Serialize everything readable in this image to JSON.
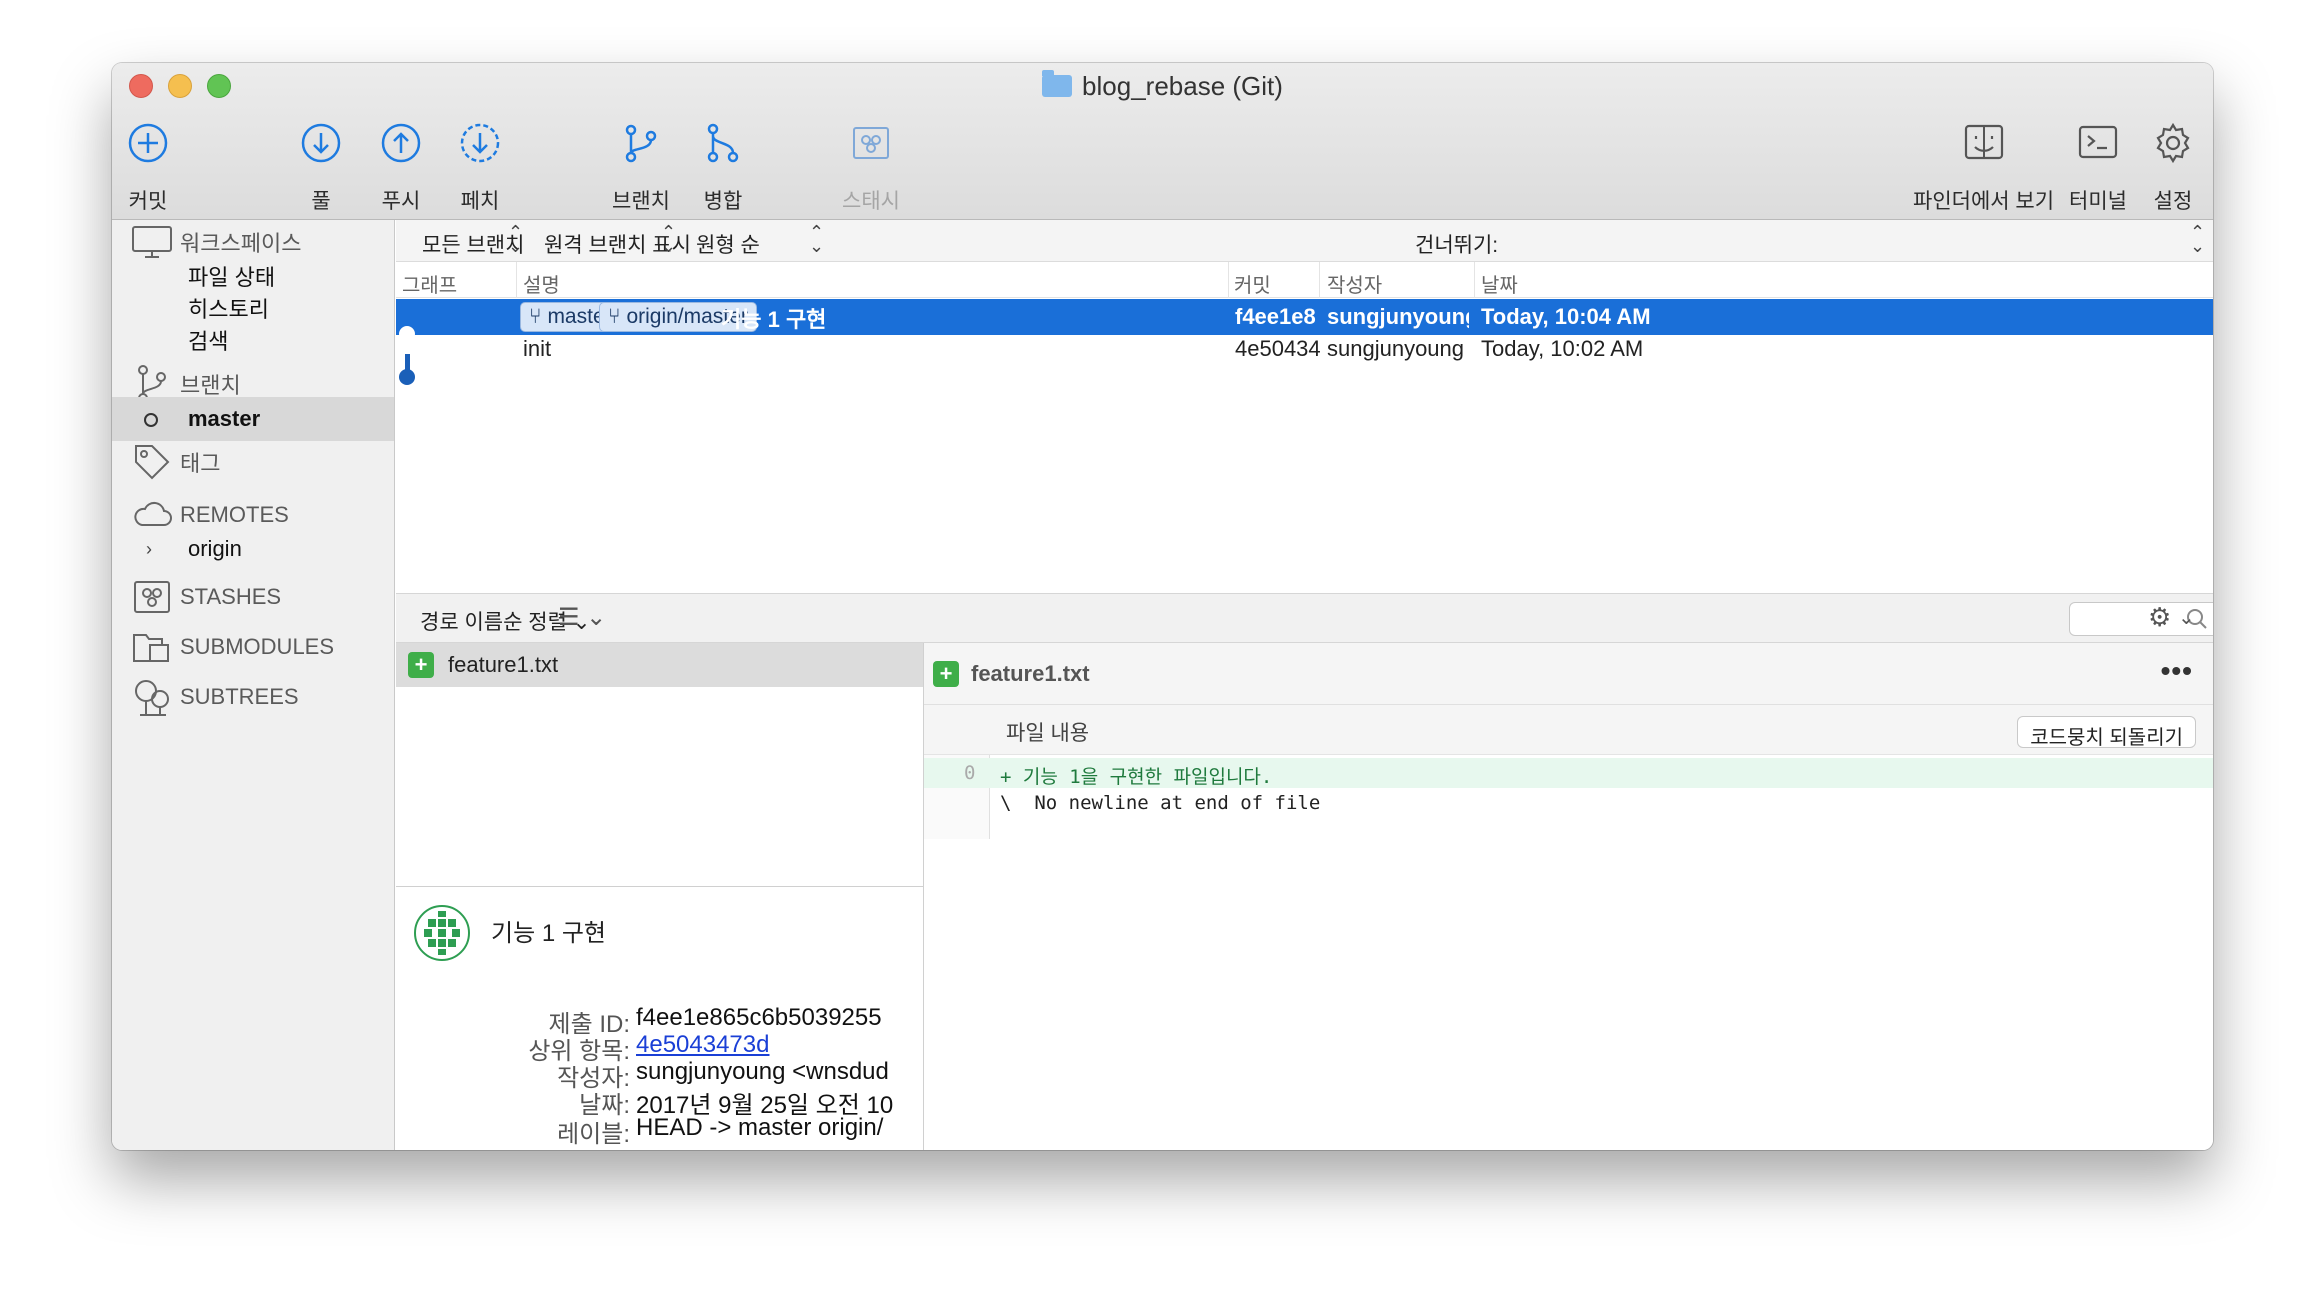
{
  "window": {
    "title": "blog_rebase (Git)"
  },
  "toolbar": {
    "commit": "커밋",
    "pull": "풀",
    "push": "푸시",
    "fetch": "페치",
    "branch": "브랜치",
    "merge": "병합",
    "stash": "스태시",
    "finder": "파인더에서 보기",
    "terminal": "터미널",
    "settings": "설정"
  },
  "sidebar": {
    "workspace": "워크스페이스",
    "file_status": "파일 상태",
    "history": "히스토리",
    "search": "검색",
    "branches": "브랜치",
    "branch_master": "master",
    "tags": "태그",
    "remotes": "REMOTES",
    "remote_origin": "origin",
    "stashes": "STASHES",
    "submodules": "SUBMODULES",
    "subtrees": "SUBTREES"
  },
  "filters": {
    "branches": "모든 브랜치",
    "remote": "원격 브랜치 표시",
    "order": "원형 순",
    "jump": "건너뛰기:"
  },
  "columns": {
    "graph": "그래프",
    "description": "설명",
    "commit": "커밋",
    "author": "작성자",
    "date": "날짜"
  },
  "commits": [
    {
      "tags": [
        "master",
        "origin/master"
      ],
      "message": "기능 1 구현",
      "hash": "f4ee1e8",
      "author": "sungjunyoung <...",
      "date": "Today, 10:04 AM",
      "selected": true
    },
    {
      "tags": [],
      "message": "init",
      "hash": "4e50434",
      "author": "sungjunyoung <w...",
      "date": "Today, 10:02 AM",
      "selected": false
    }
  ],
  "files_bar": {
    "sort": "경로 이름순 정렬",
    "search_placeholder": "검색"
  },
  "files": [
    {
      "name": "feature1.txt",
      "status": "added"
    }
  ],
  "commit_detail": {
    "subject": "기능 1 구현",
    "labels": {
      "id": "제출 ID:",
      "parent": "상위 항목:",
      "author": "작성자:",
      "date": "날짜:",
      "refs": "레이블:"
    },
    "id": "f4ee1e865c6b5039255",
    "parent": "4e5043473d",
    "author": "sungjunyoung <wnsdud",
    "date": "2017년 9월 25일 오전 10",
    "refs": "HEAD -> master origin/"
  },
  "diff": {
    "file": "feature1.txt",
    "hunk_title": "파일 내용",
    "revert": "코드뭉치 되돌리기",
    "line_number": "0",
    "added_line": "+ 기능 1을 구현한 파일입니다.",
    "no_newline": "\\  No newline at end of file"
  },
  "colors": {
    "accent": "#1a6fd8",
    "added": "#3fae49",
    "added_bg": "#e7f8ee"
  }
}
